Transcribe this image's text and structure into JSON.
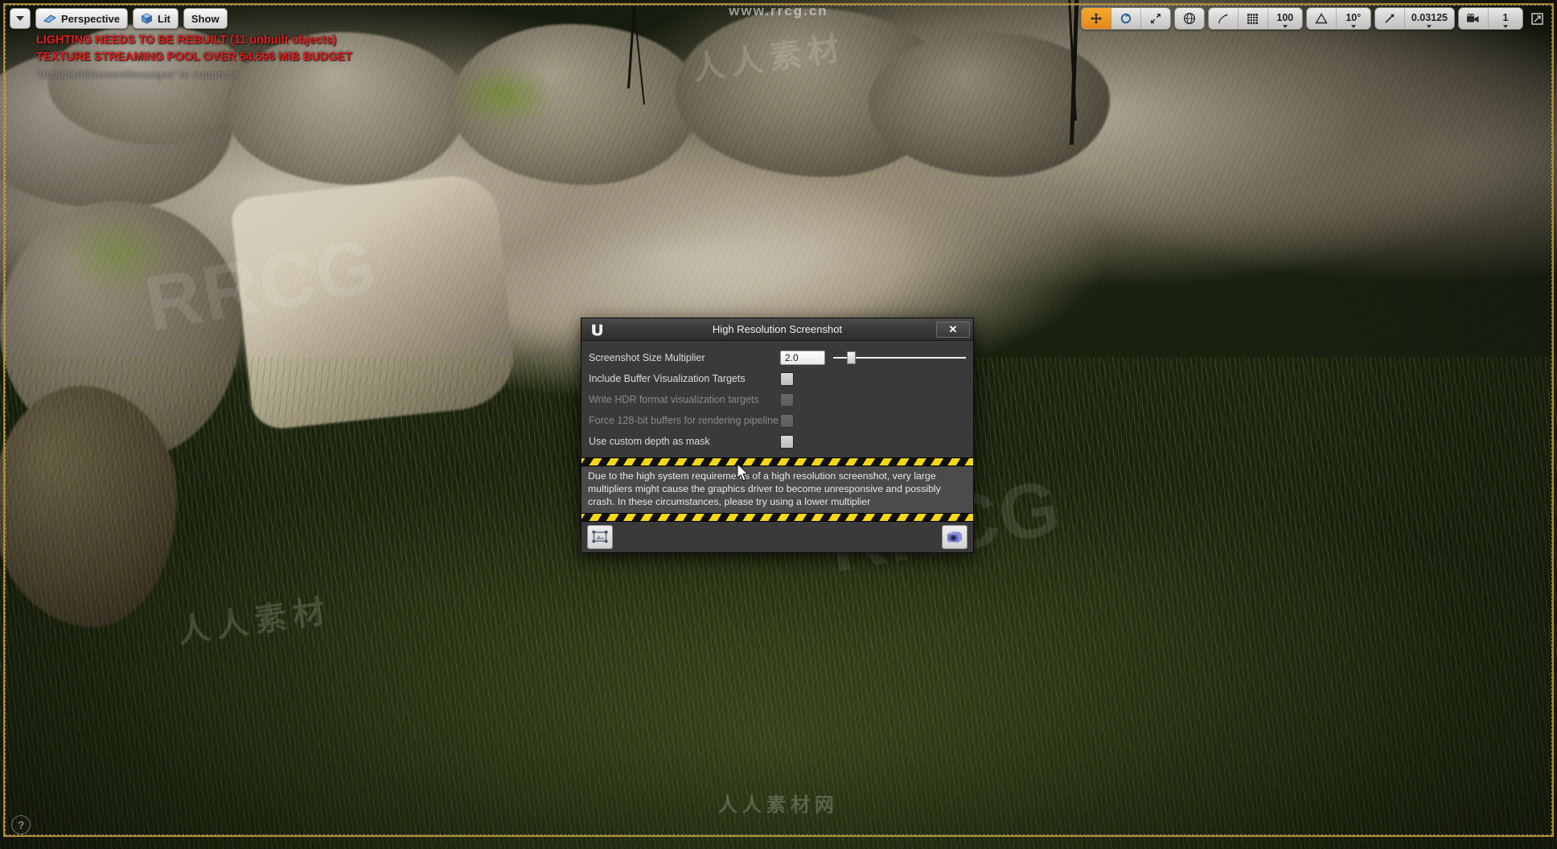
{
  "viewport": {
    "toolbar_left": {
      "menu_button_icon": "chevron-down-icon",
      "view_mode_label": "Perspective",
      "lighting_mode_label": "Lit",
      "show_menu_label": "Show"
    },
    "warnings": [
      "LIGHTING NEEDS TO BE REBUILT (11 unbuilt objects)",
      "TEXTURE STREAMING POOL OVER 54.596 MiB BUDGET"
    ],
    "warning_hint": "'DisableAllScreenMessages' to suppress",
    "toolbar_right": {
      "translate_icon": "move-gizmo-icon",
      "rotate_icon": "rotate-gizmo-icon",
      "scale_icon": "scale-gizmo-icon",
      "coordinate_system_icon": "world-globe-icon",
      "surface_snap_icon": "surface-snap-icon",
      "grid_snap_icon": "grid-snap-icon",
      "grid_snap_value": "100",
      "angle_snap_icon": "angle-snap-icon",
      "angle_snap_value": "10°",
      "scale_snap_icon": "scale-snap-icon",
      "scale_snap_value": "0.03125",
      "camera_speed_icon": "camera-speed-icon",
      "camera_speed_value": "1",
      "maximize_icon": "maximize-viewport-icon"
    },
    "help_button_label": "?",
    "watermarks": {
      "top": "www.rrcg.cn",
      "center_big": "RRCG",
      "center_cn": "人人素材",
      "bottom": "人人素材网"
    }
  },
  "dialog": {
    "title": "High Resolution Screenshot",
    "logo_glyph": "𝒰",
    "close_label": "✕",
    "rows": [
      {
        "label": "Screenshot Size Multiplier",
        "control": "spinner-slider",
        "value": "2.0",
        "disabled": false
      },
      {
        "label": "Include Buffer Visualization Targets",
        "control": "checkbox",
        "checked": false,
        "disabled": false
      },
      {
        "label": "Write HDR format visualization targets",
        "control": "checkbox",
        "checked": false,
        "disabled": true
      },
      {
        "label": "Force 128-bit buffers for rendering pipeline",
        "control": "checkbox",
        "checked": false,
        "disabled": true
      },
      {
        "label": "Use custom depth as mask",
        "control": "checkbox",
        "checked": false,
        "disabled": false
      }
    ],
    "note": "Due to the high system requirements of a high resolution screenshot, very large multipliers might cause the graphics driver to become unresponsive and possibly crash. In these circumstances, please try using a lower multiplier",
    "footer": {
      "capture_region_icon": "capture-region-icon",
      "take_screenshot_icon": "camera-icon"
    }
  },
  "colors": {
    "accent_gold": "#b0892f",
    "warning_red": "#e21d1d",
    "hazard_yellow": "#f5d718",
    "dialog_body": "#3a3a3a",
    "note_bg": "#4b4b4b",
    "gizmo_active": "#f7a92e"
  }
}
